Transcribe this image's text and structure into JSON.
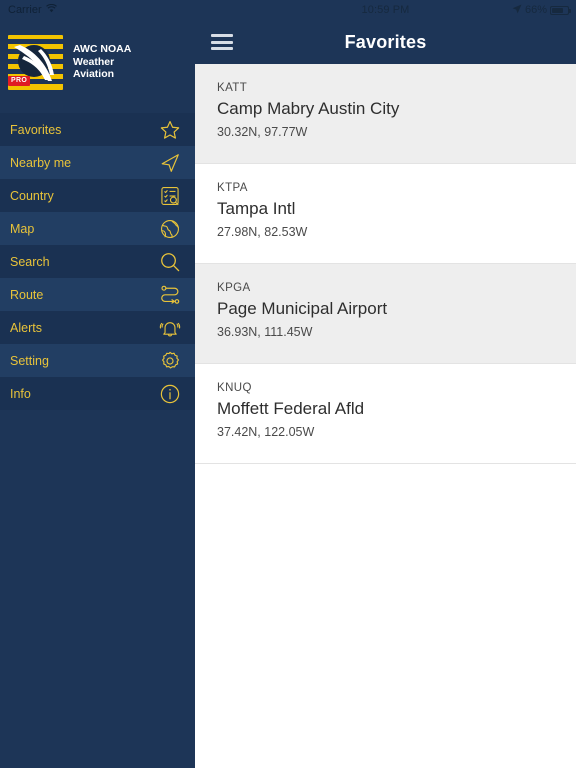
{
  "statusbar": {
    "carrier": "Carrier",
    "wifi_icon": "wifi-icon",
    "time": "10:59 PM",
    "location_icon": "location-arrow-icon",
    "battery_percent": "66%",
    "battery_icon": "battery-icon"
  },
  "sidebar": {
    "logo": {
      "badge": "PRO",
      "line1": "AWC NOAA",
      "line2": "Weather",
      "line3": "Aviation",
      "icon": "aviation-logo-icon"
    },
    "items": [
      {
        "label": "Favorites",
        "icon": "star-icon"
      },
      {
        "label": "Nearby me",
        "icon": "navigation-arrow-icon"
      },
      {
        "label": "Country",
        "icon": "checklist-search-icon"
      },
      {
        "label": "Map",
        "icon": "globe-icon"
      },
      {
        "label": "Search",
        "icon": "magnifier-icon"
      },
      {
        "label": "Route",
        "icon": "route-path-icon"
      },
      {
        "label": "Alerts",
        "icon": "bell-icon"
      },
      {
        "label": "Setting",
        "icon": "gear-icon"
      },
      {
        "label": "Info",
        "icon": "info-circle-icon"
      }
    ]
  },
  "navbar": {
    "menu_icon": "hamburger-menu-icon",
    "title": "Favorites"
  },
  "list": {
    "items": [
      {
        "code": "KATT",
        "name": "Camp Mabry Austin City",
        "coords": "30.32N, 97.77W"
      },
      {
        "code": "KTPA",
        "name": "Tampa Intl",
        "coords": "27.98N, 82.53W"
      },
      {
        "code": "KPGA",
        "name": "Page Municipal Airport",
        "coords": "36.93N, 111.45W"
      },
      {
        "code": "KNUQ",
        "name": "Moffett Federal Afld",
        "coords": "37.42N, 122.05W"
      }
    ]
  },
  "colors": {
    "navy": "#1d3557",
    "sidebar_row_alt": "#223e63",
    "sidebar_row_base": "#1a3152",
    "accent_yellow": "#e8c33a",
    "logo_yellow": "#f2c300",
    "pro_red": "#e01b24",
    "row_shade": "#eeeeee"
  }
}
